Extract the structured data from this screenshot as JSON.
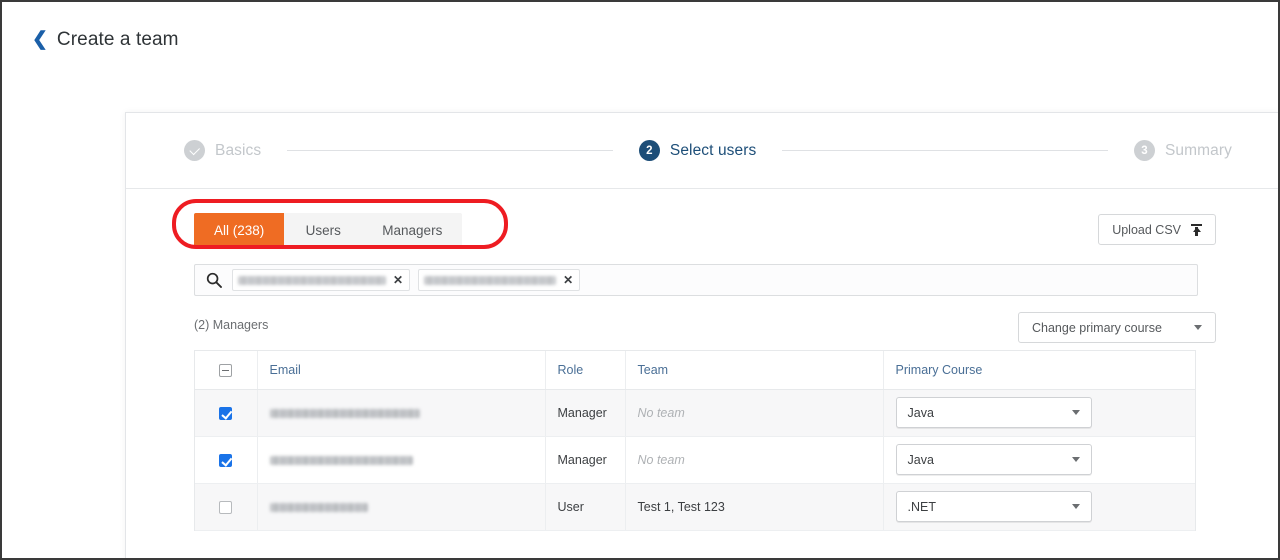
{
  "header": {
    "back_icon": "chevron-left-icon",
    "title": "Create a team"
  },
  "stepper": {
    "steps": [
      {
        "index": "1",
        "label": "Basics",
        "state": "done"
      },
      {
        "index": "2",
        "label": "Select users",
        "state": "active"
      },
      {
        "index": "3",
        "label": "Summary",
        "state": "todo"
      }
    ]
  },
  "tabs": {
    "items": [
      {
        "label": "All (238)",
        "active": true
      },
      {
        "label": "Users",
        "active": false
      },
      {
        "label": "Managers",
        "active": false
      }
    ],
    "highlight_color": "#ee1c22",
    "active_color": "#ef6c23"
  },
  "toolbar": {
    "upload_csv_label": "Upload CSV",
    "upload_icon": "upload-icon"
  },
  "search": {
    "icon": "search-icon",
    "placeholder": "",
    "value": "",
    "chips": [
      {
        "label": "",
        "redacted": true,
        "width": 148,
        "remove_icon": "close-icon"
      },
      {
        "label": "",
        "redacted": true,
        "width": 132,
        "remove_icon": "close-icon"
      }
    ]
  },
  "subhead": {
    "group_label": "(2) Managers",
    "change_course_label": "Change primary course",
    "change_course_caret": "chevron-down-icon"
  },
  "table": {
    "select_all_state": "indeterminate",
    "columns": [
      "",
      "Email",
      "Role",
      "Team",
      "Primary Course"
    ],
    "rows": [
      {
        "checked": true,
        "email": "",
        "email_redacted": true,
        "email_width": 150,
        "role": "Manager",
        "team": "No team",
        "team_empty": true,
        "course": "Java",
        "shaded": true
      },
      {
        "checked": true,
        "email": "",
        "email_redacted": true,
        "email_width": 143,
        "role": "Manager",
        "team": "No team",
        "team_empty": true,
        "course": "Java",
        "shaded": false
      },
      {
        "checked": false,
        "email": "",
        "email_redacted": true,
        "email_width": 98,
        "role": "User",
        "team": "Test 1, Test 123",
        "team_empty": false,
        "course": ".NET",
        "shaded": true
      }
    ]
  }
}
